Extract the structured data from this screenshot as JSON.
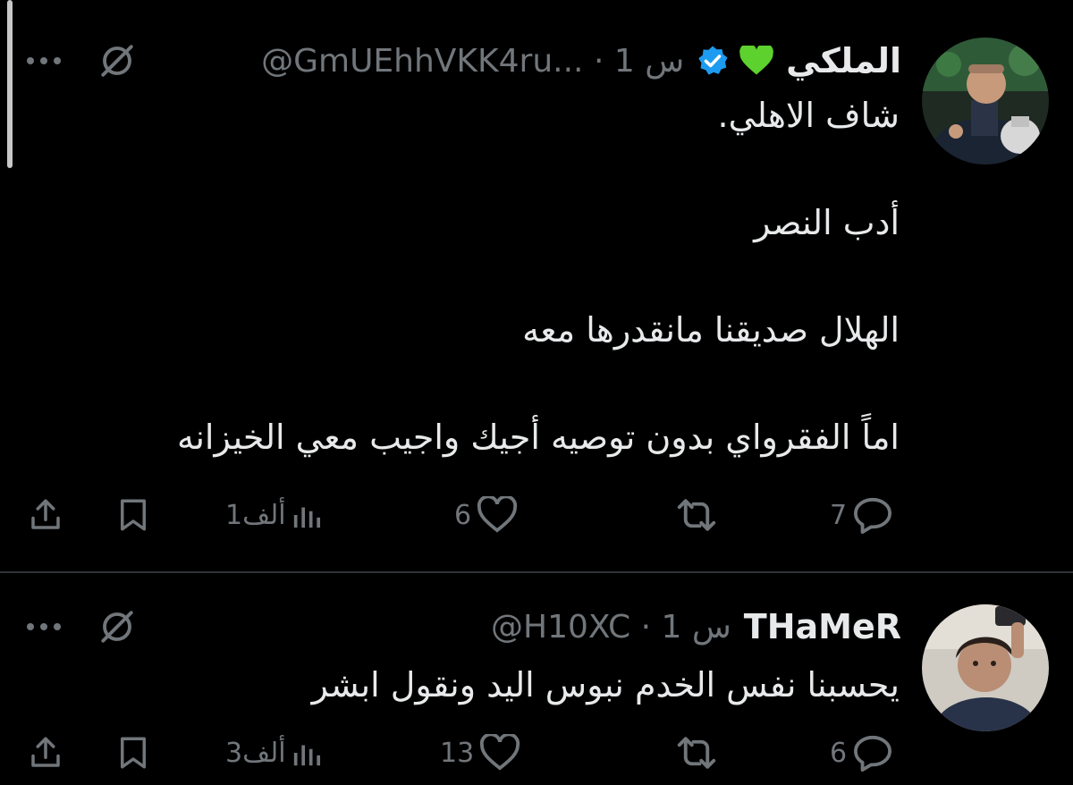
{
  "tweets": [
    {
      "display_name": "الملكي",
      "name_emoji": "green-heart-icon",
      "verified": true,
      "handle": "@GmUEhhVKK4ru...",
      "separator": "·",
      "time": "1 س",
      "body": [
        "شاف الاهلي.",
        "أدب النصر",
        "الهلال صديقنا مانقدرها معه",
        "اماً الفقرواي بدون توصيه أجيك واجيب معي الخيزانه"
      ],
      "replies": "7",
      "retweets": "",
      "likes": "6",
      "views": "1ألف"
    },
    {
      "display_name": "THaMeR",
      "handle": "@H10XC",
      "separator": "·",
      "time": "1 س",
      "body": [
        "يحسبنا نفس الخدم نبوس اليد ونقول ابشر"
      ],
      "replies": "6",
      "retweets": "",
      "likes": "13",
      "views": "3ألف"
    }
  ],
  "colors": {
    "background": "#000000",
    "text": "#e7e9ea",
    "muted": "#71767b",
    "verified": "#1d9bf0",
    "heart": "#5dd12e",
    "divider": "#2f3336"
  }
}
